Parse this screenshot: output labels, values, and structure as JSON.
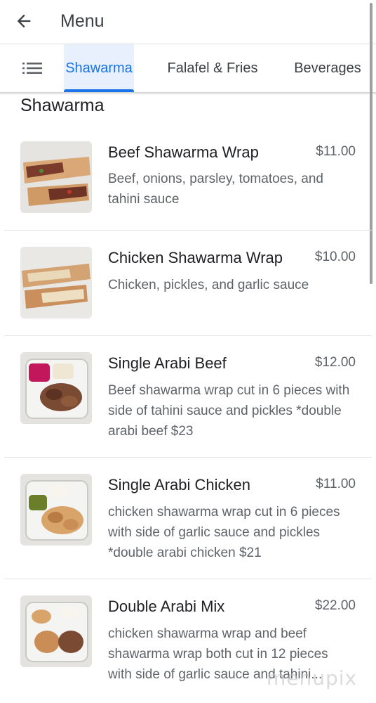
{
  "header": {
    "title": "Menu",
    "back_icon": "arrow-back-icon"
  },
  "tabs": {
    "list_icon": "list-icon",
    "items": [
      {
        "label": "Shawarma",
        "active": true
      },
      {
        "label": "Falafel & Fries",
        "active": false
      },
      {
        "label": "Beverages",
        "active": false
      }
    ],
    "accent_color": "#1a73e8"
  },
  "section": {
    "title": "Shawarma"
  },
  "items": [
    {
      "name": "Beef Shawarma Wrap",
      "price": "$11.00",
      "desc": "Beef, onions, parsley, tomatoes, and tahini sauce"
    },
    {
      "name": "Chicken Shawarma Wrap",
      "price": "$10.00",
      "desc": "Chicken, pickles, and garlic sauce"
    },
    {
      "name": "Single Arabi Beef",
      "price": "$12.00",
      "desc": "Beef shawarma wrap cut in 6 pieces with side of tahini sauce and pickles *double arabi beef $23"
    },
    {
      "name": "Single Arabi Chicken",
      "price": "$11.00",
      "desc": "chicken shawarma wrap cut in 6 pieces with side of garlic sauce and pickles *double arabi chicken $21"
    },
    {
      "name": "Double Arabi Mix",
      "price": "$22.00",
      "desc": "chicken shawarma wrap and beef shawarma wrap both cut in 12 pieces with side of garlic sauce and tahini..."
    }
  ],
  "watermark": "menupix"
}
